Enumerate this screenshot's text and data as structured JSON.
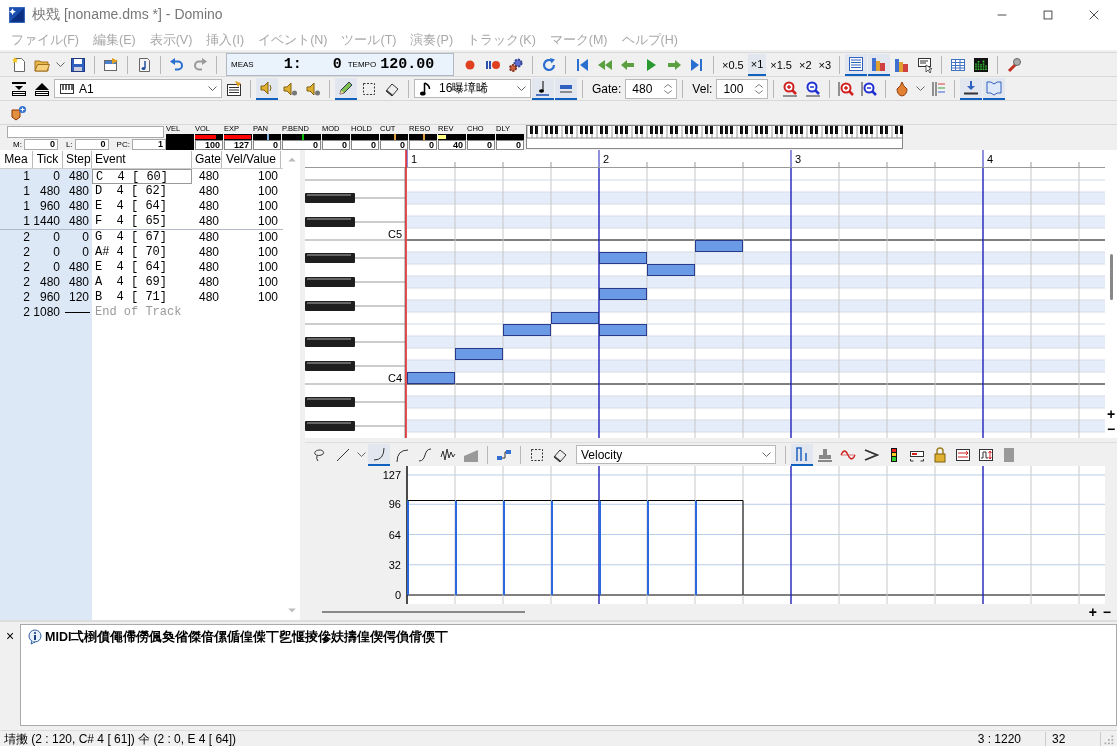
{
  "window": {
    "title": "柍戣 [noname.dms *] - Domino"
  },
  "menu": [
    "ファイル(F)",
    "編集(E)",
    "表示(V)",
    "挿入(I)",
    "イベント(N)",
    "ツール(T)",
    "演奏(P)",
    "トラック(K)",
    "マーク(M)",
    "ヘルプ(H)"
  ],
  "main_toolbar": {
    "counter": {
      "measure_label": "MEAS",
      "measure": "1:",
      "tick": "0",
      "tempo_label": "TEMPO",
      "tempo": "120.00"
    },
    "speeds": [
      {
        "label": "×0.5",
        "selected": false
      },
      {
        "label": "×1",
        "selected": true
      },
      {
        "label": "×1.5",
        "selected": false
      },
      {
        "label": "×2",
        "selected": false
      },
      {
        "label": "×3",
        "selected": false
      }
    ],
    "views": [
      {
        "selected": true
      },
      {
        "selected": true
      },
      {
        "selected": false
      },
      {
        "selected": false
      }
    ]
  },
  "edit_toolbar": {
    "track": "A1",
    "play_modes": [
      {
        "selected": true
      },
      {
        "selected": false
      },
      {
        "selected": false
      }
    ],
    "tools": [
      {
        "selected": true
      },
      {
        "selected": false
      },
      {
        "selected": false
      }
    ],
    "note_length": "16曝墇晞",
    "length_modes": [
      {
        "selected": true
      },
      {
        "selected": true
      }
    ],
    "gate": {
      "label": "Gate:",
      "value": "480"
    },
    "velocity": {
      "label": "Vel:",
      "value": "100"
    },
    "input_modes": [
      {
        "selected": true
      },
      {
        "selected": true
      }
    ]
  },
  "controllers": {
    "fields": [
      {
        "label": "M:",
        "value": "0"
      },
      {
        "label": "L:",
        "value": "0"
      },
      {
        "label": "PC:",
        "value": "1"
      }
    ],
    "meters": [
      {
        "label": "VEL",
        "kind": "solid"
      },
      {
        "label": "VOL",
        "kind": "fill",
        "level": 0.79,
        "color": "#ff0000",
        "value": "100"
      },
      {
        "label": "EXP",
        "kind": "fill",
        "level": 1,
        "color": "#ff0000",
        "value": "127"
      },
      {
        "label": "PAN",
        "kind": "center",
        "color": "#80b0e0",
        "value": "0"
      },
      {
        "label": "P.BEND",
        "kind": "center",
        "color": "#00c000",
        "value": "0"
      },
      {
        "label": "MOD",
        "kind": "empty",
        "value": "0"
      },
      {
        "label": "HOLD",
        "kind": "empty",
        "value": "0"
      },
      {
        "label": "CUT",
        "kind": "center",
        "color": "#e0a040",
        "value": "0"
      },
      {
        "label": "RESO",
        "kind": "center",
        "color": "#e0a040",
        "value": "0"
      },
      {
        "label": "REV",
        "kind": "fill",
        "level": 0.31,
        "color": "#ffff80",
        "value": "40"
      },
      {
        "label": "CHO",
        "kind": "empty",
        "value": "0"
      },
      {
        "label": "DLY",
        "kind": "empty",
        "value": "0"
      }
    ]
  },
  "event_list": {
    "columns": [
      "Mea",
      "Tick",
      "Step",
      "Event",
      "Gate",
      "Vel/Value"
    ],
    "rows": [
      {
        "kind": "note",
        "mea": "1",
        "tick": "0",
        "step": "480",
        "event": "C  4 [ 60]",
        "gate": "480",
        "value": "100",
        "selected": true
      },
      {
        "kind": "note",
        "mea": "1",
        "tick": "480",
        "step": "480",
        "event": "D  4 [ 62]",
        "gate": "480",
        "value": "100",
        "selected": false
      },
      {
        "kind": "note",
        "mea": "1",
        "tick": "960",
        "step": "480",
        "event": "E  4 [ 64]",
        "gate": "480",
        "value": "100",
        "selected": false
      },
      {
        "kind": "note",
        "mea": "1",
        "tick": "1440",
        "step": "480",
        "event": "F  4 [ 65]",
        "gate": "480",
        "value": "100",
        "selected": false
      },
      {
        "kind": "note",
        "mea": "2",
        "tick": "0",
        "step": "0",
        "event": "G  4 [ 67]",
        "gate": "480",
        "value": "100",
        "selected": false
      },
      {
        "kind": "note",
        "mea": "2",
        "tick": "0",
        "step": "0",
        "event": "A# 4 [ 70]",
        "gate": "480",
        "value": "100",
        "selected": false
      },
      {
        "kind": "note",
        "mea": "2",
        "tick": "0",
        "step": "480",
        "event": "E  4 [ 64]",
        "gate": "480",
        "value": "100",
        "selected": false
      },
      {
        "kind": "note",
        "mea": "2",
        "tick": "480",
        "step": "480",
        "event": "A  4 [ 69]",
        "gate": "480",
        "value": "100",
        "selected": false
      },
      {
        "kind": "note",
        "mea": "2",
        "tick": "960",
        "step": "120",
        "event": "B  4 [ 71]",
        "gate": "480",
        "value": "100",
        "selected": false
      },
      {
        "kind": "end",
        "mea": "2",
        "tick": "1080",
        "event": "End of Track",
        "selected": false
      }
    ]
  },
  "piano_roll": {
    "measures": [
      "1",
      "2",
      "3",
      "4"
    ],
    "key_labels": [
      "C5",
      "C4"
    ],
    "zoom": [
      "+",
      "−"
    ]
  },
  "velocity_lane": {
    "curve_tools": [
      {
        "selected": false
      },
      {
        "selected": false
      },
      {
        "selected": true
      },
      {
        "selected": false
      },
      {
        "selected": false
      },
      {
        "selected": false
      },
      {
        "selected": false
      }
    ],
    "controller": "Velocity",
    "lane_tools": [
      {
        "selected": true
      },
      {
        "selected": false
      },
      {
        "selected": false
      },
      {
        "selected": false
      },
      {
        "selected": false
      },
      {
        "selected": false
      },
      {
        "selected": false
      },
      {
        "selected": false
      },
      {
        "selected": false
      },
      {
        "selected": false
      }
    ],
    "axis": [
      "127",
      "96",
      "64",
      "32",
      "0"
    ],
    "zoom": [
      "+",
      "−"
    ]
  },
  "message": {
    "close": "×",
    "text": "MIDI弌椡僨僶僀僗偑奐偗傑偣傫偱偟偨丅乮愝掕傪妋擣偟偰偔偩偝偄丅"
  },
  "status_bar": {
    "text": "埥擻 (2 : 120, C# 4 [ 61]) 仐 (2 : 0, E  4 [ 64])",
    "position": "3 : 1220",
    "value": "32"
  }
}
